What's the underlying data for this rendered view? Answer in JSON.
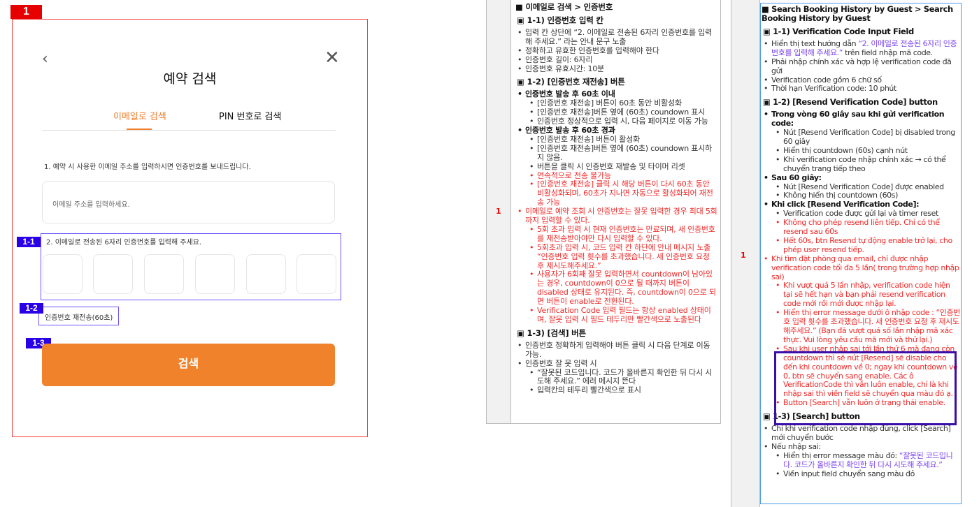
{
  "mock": {
    "tag": "1",
    "title": "예약 검색",
    "back_icon": "‹",
    "close_icon": "✕",
    "tabs": [
      "이메일로 검색",
      "PIN 번호로 검색"
    ],
    "step1_label": "1. 예약 시 사용한 이메일 주소를 입력하시면 인증번호를 보내드립니다.",
    "email_placeholder": "이메일 주소를 입력하세요.",
    "step2_label": "2. 이메일로 전송된 6자리 인증번호를 입력해 주세요.",
    "resend_label": "인증번호 재전송(60초)",
    "search_label": "검색",
    "tags": {
      "t11": "1-1",
      "t12": "1-2",
      "t13": "1-3"
    }
  },
  "ko_doc": {
    "row_num": "1",
    "title": "■ 이메일로 검색 > 인증번호",
    "sections": [
      {
        "heading": "▣ 1-1) 인증번호 입력 칸",
        "items": [
          {
            "t": "입력 칸 상단에 “2. 이메일로 전송된 6자리 인증번호를 입력해 주세요.” 라는 안내 문구 노출"
          },
          {
            "t": "정확하고 유효한 인증번호를 입력해야 한다"
          },
          {
            "t": "인증번호 길이: 6자리"
          },
          {
            "t": "인증번호 유효시간: 10분"
          }
        ]
      },
      {
        "heading": "▣ 1-2) [인증번호 재전송] 버튼",
        "items": [
          {
            "t": "인증번호 발송 후 60초 이내",
            "s": "b"
          },
          {
            "t": "[인증번호 재전송] 버튼이 60초 동안 비활성화",
            "l": 2
          },
          {
            "t": "[인증번호 재전송]버튼 옆에 (60초) coundown 표시",
            "l": 2
          },
          {
            "t": "인증번호 정상적으로 입력 시, 다음 페이지로 이동 가능",
            "l": 2
          },
          {
            "t": "인증번호 발송 후 60초 경과",
            "s": "b"
          },
          {
            "t": "[인증번호 재전송] 버튼이 활성화",
            "l": 2
          },
          {
            "t": "[인증번호 재전송]버튼 옆에 (60초) coundown 표시하지 않음.",
            "l": 2
          },
          {
            "t": "버튼을 클릭 시 인증번호 재발송 및 타이머 리셋",
            "l": 2
          },
          {
            "t": "연속적으로 전송 불가능",
            "l": 2,
            "s": "r"
          },
          {
            "t": "[인증번호 재전송] 클릭 시 해당 버튼이 다시 60초 동안 비활성화되며, 60초가 지나면 자동으로 활성화되어 재전송 가능",
            "l": 2,
            "s": "r"
          },
          {
            "t": "이메일로 예약 조회 시 인증번호는 잘못 입력한 경우 최대 5회까지 입력할 수 있다.",
            "s": "r"
          },
          {
            "t": "5회 초과 입력 시 현재 인증번호는 만료되며, 새 인증번호를 재전송받아야만 다시 입력할 수 있다.",
            "l": 2,
            "s": "r"
          },
          {
            "t": "5회초과 입력 시, 코드 입력 칸 하단에 안내 메시지 노출 “인증번호 입력 횟수를 초과했습니다. 새 인증번호 요청 후 재시도해주세요.”",
            "l": 2,
            "s": "r"
          },
          {
            "t": "사용자가 6회째 잘못 입력하면서 countdown이 남아있는 경우, countdown이 0으로 될 때까지 버튼이 disabled 상태로 유지된다. 즉, countdown이 0으로 되면 버튼이 enable로 전환된다.",
            "l": 2,
            "s": "r"
          },
          {
            "t": "Verification Code 입력 필드는 항상 enabled 상태이며, 잘못 입력 시 필드 테두리만 빨간색으로 노출된다",
            "l": 2,
            "s": "r"
          }
        ]
      },
      {
        "heading": "▣ 1-3) [검색] 버튼",
        "items": [
          {
            "t": "인증번호 정확하게 입력해야 버튼 클릭 시 다음 단계로 이동 가능."
          },
          {
            "t": "인증번호 잘 못 입력 시"
          },
          {
            "t": "“잘못된 코드입니다. 코드가 올바른지 확인한 뒤 다시 시도해 주세요.” 에러 메시지 뜬다",
            "l": 2
          },
          {
            "t": "입력칸의 테두리 빨간색으로 표시",
            "l": 2
          }
        ]
      }
    ]
  },
  "vi_doc": {
    "row_num": "1",
    "title": "■ Search Booking History by Guest  > Search Booking History by Guest",
    "sections": [
      {
        "heading": "▣ 1-1) Verification Code Input Field",
        "items": [
          {
            "t": "Hiển thị text hướng dẫn ",
            "p": "“2. 이메일로 전송된 6자리 인증번호를 입력해 주세요.”",
            "t2": " trên field nhập mã code."
          },
          {
            "t": "Phải nhập chính xác và hợp lệ verification code đã gửi"
          },
          {
            "t": "Verification code  gồm 6 chữ số"
          },
          {
            "t": "Thời hạn Verification code: 10 phút"
          }
        ]
      },
      {
        "heading": "▣ 1-2)  [Resend Verification Code] button",
        "items": [
          {
            "t": "Trong vòng 60 giây sau khi gửi verification code:",
            "s": "b"
          },
          {
            "t": "Nút [Resend Verification Code] bị disabled trong 60 giây",
            "l": 2
          },
          {
            "t": "Hiển thị countdown (60s) cạnh nút",
            "l": 2
          },
          {
            "t": "Khi verification code nhập chính xác → có thể chuyển trang tiếp theo",
            "l": 2
          },
          {
            "t": "Sau 60 giây:",
            "s": "b"
          },
          {
            "t": "Nút [Resend Verification Code] được enabled",
            "l": 2
          },
          {
            "t": "Không hiển thị countdown (60s)",
            "l": 2
          },
          {
            "t": "Khi click [Resend Verification Code]:",
            "s": "b"
          },
          {
            "t": "Verification code được gửi lại và timer reset",
            "l": 2
          },
          {
            "t": "Không cho phép resend liên tiếp. Chỉ có thể resend sau 60s",
            "l": 2,
            "s": "r"
          },
          {
            "t": "Hết 60s, btn Resend tự động enable trở lại, cho phép user resend tiếp.",
            "l": 2,
            "s": "r"
          },
          {
            "t": "Khi tìm đặt phòng qua email, chỉ được nhập verification code tối đa 5 lần( trong trường hợp nhập sai)",
            "s": "r"
          },
          {
            "t": "Khi vượt quá 5 lần nhập, verification code hiện tại sẽ hết hạn và bạn phải resend verification code mới rồi mới được nhập lại.",
            "l": 2,
            "s": "r"
          },
          {
            "t": "Hiển thị  error message dưới ô nhập code : “인증번호 입력 횟수를 초과했습니다. 새 인증번호 요청 후 재시도해주세요.” (Bạn đã vượt quá số lần nhập mã xác thực. Vui lòng yêu cầu mã mới và thử lại.)",
            "l": 2,
            "s": "r"
          },
          {
            "t": "Sau khi user nhập sai tới lần thứ 6 mà đang còn countdown thì sẽ  nút [Resend] sẽ disable cho đến khi countdown về 0; ngay khi countdown về 0, btn sẽ chuyển sang enable.  Các ô VerificationCode thì vẫn luôn enable, chỉ là khi nhập sai thì viền field sẽ chuyển qua màu đỏ ạ.",
            "l": 2,
            "s": "r"
          },
          {
            "t": "Button [Search] vẫn luôn ở trạng thái enable.",
            "l": 2,
            "s": "r"
          }
        ]
      },
      {
        "heading": "▣ 1-3) [Search] button",
        "items": [
          {
            "t": "Chỉ khi verification code nhập đúng, click [Search] mới chuyển bước"
          },
          {
            "t": "Nếu nhập sai:"
          },
          {
            "t": "Hiển thị error message màu đỏ: ",
            "p": "“잘못된 코드입니다. 코드가 올바른지 확인한 뒤 다시 시도해 주세요.”",
            "l": 2
          },
          {
            "t": "Viền input field chuyển sang màu đỏ",
            "l": 2
          }
        ]
      }
    ]
  }
}
